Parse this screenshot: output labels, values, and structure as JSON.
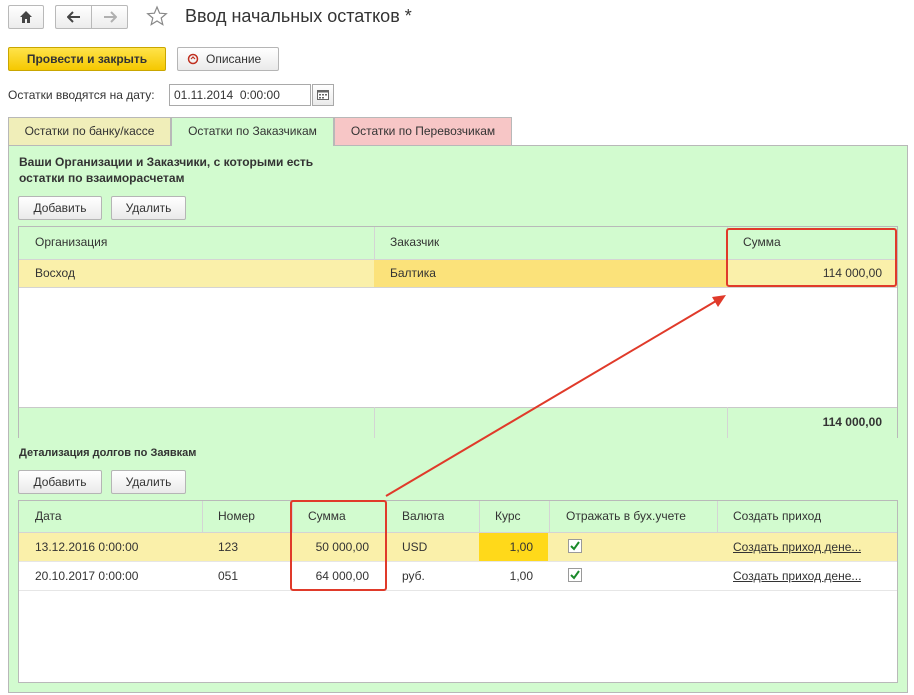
{
  "header": {
    "title": "Ввод начальных остатков *",
    "home_icon": "home-icon",
    "back_icon": "arrow-left-icon",
    "forward_icon": "arrow-right-icon",
    "star_icon": "star-icon"
  },
  "toolbar": {
    "post_close_label": "Провести и закрыть",
    "description_label": "Описание"
  },
  "date_field": {
    "label": "Остатки вводятся на дату:",
    "value": "01.11.2014  0:00:00"
  },
  "tabs": [
    {
      "label": "Остатки по банку/кассе"
    },
    {
      "label": "Остатки по Заказчикам"
    },
    {
      "label": "Остатки по Перевозчикам"
    }
  ],
  "top_section": {
    "title_line1": "Ваши Организации и Заказчики, с которыми есть",
    "title_line2": "остатки по взаиморасчетам",
    "add_label": "Добавить",
    "delete_label": "Удалить",
    "columns": [
      "Организация",
      "Заказчик",
      "Сумма"
    ],
    "rows": [
      {
        "org": "Восход",
        "customer": "Балтика",
        "sum": "114 000,00"
      }
    ],
    "total": "114 000,00"
  },
  "bottom_section": {
    "title": "Детализация долгов по Заявкам",
    "add_label": "Добавить",
    "delete_label": "Удалить",
    "columns": [
      "Дата",
      "Номер",
      "Сумма",
      "Валюта",
      "Курс",
      "Отражать в бух.учете",
      "Создать приход"
    ],
    "rows": [
      {
        "date": "13.12.2016 0:00:00",
        "number": "123",
        "sum": "50 000,00",
        "currency": "USD",
        "rate": "1,00",
        "reflect": true,
        "create": "Создать приход дене..."
      },
      {
        "date": "20.10.2017 0:00:00",
        "number": "051",
        "sum": "64 000,00",
        "currency": "руб.",
        "rate": "1,00",
        "reflect": true,
        "create": "Создать приход дене..."
      }
    ]
  },
  "colors": {
    "panel_bg": "#d2fbcf",
    "selected_row": "#faf0aa",
    "highlight_cell": "#ffd91a",
    "primary_button": "#f5c800",
    "annotation": "#e03a2a"
  }
}
